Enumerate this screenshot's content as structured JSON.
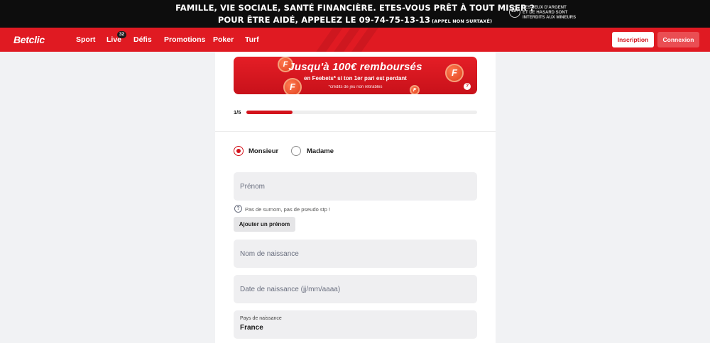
{
  "banner": {
    "line1": "FAMILLE, VIE SOCIALE, SANTÉ FINANCIÈRE. ETES-VOUS PRÊT À TOUT MISER ?",
    "line2": "POUR ÊTRE AIDÉ, APPELEZ LE 09-74-75-13-13",
    "line2_small": "(APPEL NON SURTAXÉ)",
    "age_badge": "18+",
    "age_text_1": "LES JEUX D'ARGENT",
    "age_text_2": "ET DE HASARD SONT",
    "age_text_3": "INTERDITS AUX MINEURS"
  },
  "nav": {
    "logo": "Betclic",
    "items": [
      "Sport",
      "Live",
      "Défis",
      "Promotions",
      "Poker",
      "Turf"
    ],
    "live_count": "32",
    "register_label": "Inscription",
    "login_label": "Connexion"
  },
  "promo": {
    "title": "Jusqu'à 100€ remboursés",
    "subtitle": "en Feebets* si ton 1er pari est perdant",
    "note": "*crédits de jeu non retirables",
    "coin_letter": "F",
    "help_glyph": "?"
  },
  "progress": {
    "label": "1/5",
    "fraction": 0.2
  },
  "gender": {
    "options": [
      "Monsieur",
      "Madame"
    ],
    "selected": "Monsieur"
  },
  "form": {
    "first_name_placeholder": "Prénom",
    "hint": "Pas de surnom, pas de pseudo stp !",
    "add_first_name_label": "Ajouter un prénom",
    "birth_name_placeholder": "Nom de naissance",
    "birth_date_placeholder": "Date de naissance (jj/mm/aaaa)",
    "birth_country_label": "Pays de naissance",
    "birth_country_value": "France"
  },
  "colors": {
    "brand_red": "#e01a22",
    "accent_red": "#d3131c",
    "field_bg": "#efeff1",
    "page_bg": "#f1f2f4"
  }
}
